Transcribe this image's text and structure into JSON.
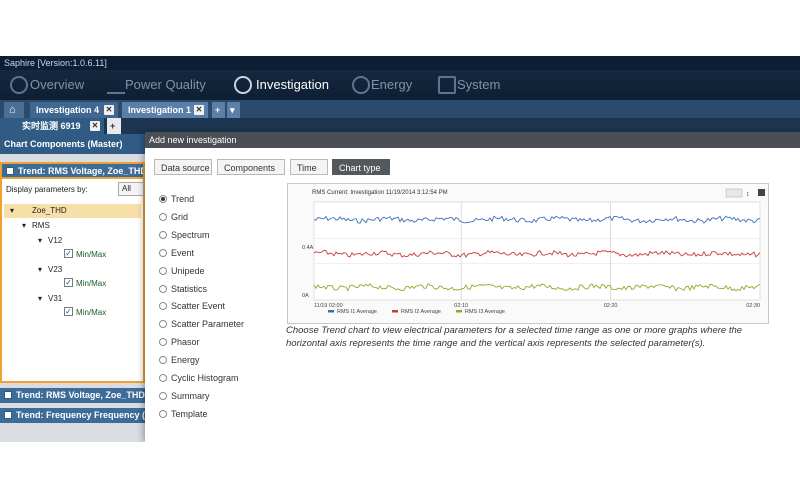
{
  "window": {
    "title": "Saphire [Version:1.0.6.11]"
  },
  "nav": [
    {
      "label": "Overview",
      "icon": "overview-icon"
    },
    {
      "label": "Power Quality",
      "icon": "waveform-icon"
    },
    {
      "label": "Investigation",
      "icon": "investigation-icon"
    },
    {
      "label": "Energy",
      "icon": "energy-icon"
    },
    {
      "label": "System",
      "icon": "system-icon"
    }
  ],
  "tabs": [
    {
      "label": "Investigation 4",
      "close": "✕"
    },
    {
      "label": "Investigation 1",
      "close": "✕"
    }
  ],
  "tab_add": "+",
  "tab_menu": "▾",
  "subtab": {
    "label": "实时监测 6919",
    "close": "✕",
    "add": "+"
  },
  "left": {
    "header": "Chart Components (Master)",
    "card1": "Trend: RMS Voltage, Zoe_THD",
    "display_by": "Display parameters by:",
    "display_value": "All",
    "tree": {
      "root": "Zoe_THD",
      "group": "RMS",
      "items": [
        {
          "name": "V12",
          "check": "Min/Max"
        },
        {
          "name": "V23",
          "check": "Min/Max"
        },
        {
          "name": "V31",
          "check": "Min/Max"
        }
      ]
    },
    "card2": "Trend: RMS Voltage, Zoe_THD",
    "card3": "Trend: Frequency Frequency (..."
  },
  "dialog": {
    "title": "Add new investigation",
    "crumbs": [
      "Data source",
      "Components",
      "Time",
      "Chart type"
    ],
    "chart_types": [
      "Trend",
      "Grid",
      "Spectrum",
      "Event",
      "Unipede",
      "Statistics",
      "Scatter Event",
      "Scatter Parameter",
      "Phasor",
      "Energy",
      "Cyclic Histogram",
      "Summary",
      "Template"
    ],
    "selected": "Trend",
    "description": "Choose Trend chart to view electrical parameters for a selected time range as one or more graphs where the horizontal axis represents the time range and the vertical axis represents the selected parameter(s)."
  },
  "chart_data": {
    "type": "line",
    "title": "RMS Current: Investigation 11/19/2014 3:12:54 PM",
    "x": [
      "11/19 02:00",
      "02:10",
      "02:20",
      "02:30"
    ],
    "yticks": [
      "0.4A",
      "0A"
    ],
    "series": [
      {
        "name": "RMS I1 Average",
        "color": "#3a6fb5",
        "level": 0.82
      },
      {
        "name": "RMS I2 Average",
        "color": "#c73a3a",
        "level": 0.47
      },
      {
        "name": "RMS I3 Average",
        "color": "#9aa32a",
        "level": 0.13
      }
    ]
  }
}
